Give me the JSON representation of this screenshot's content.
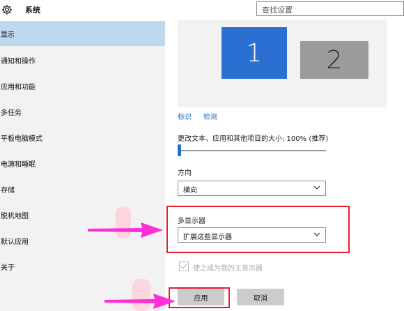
{
  "header": {
    "title": "系统",
    "search_placeholder": "查找设置"
  },
  "sidebar": {
    "items": [
      {
        "label": "显示",
        "active": true
      },
      {
        "label": "通知和操作"
      },
      {
        "label": "应用和功能"
      },
      {
        "label": "多任务"
      },
      {
        "label": "平板电脑模式"
      },
      {
        "label": "电源和睡眠"
      },
      {
        "label": "存储"
      },
      {
        "label": "脱机地图"
      },
      {
        "label": "默认应用"
      },
      {
        "label": "关于"
      }
    ]
  },
  "display": {
    "monitors": [
      "1",
      "2"
    ],
    "identify_label": "标识",
    "detect_label": "检测",
    "scale_label": "更改文本、应用和其他项目的大小: 100% (推荐)",
    "scale_value": 0,
    "orientation_label": "方向",
    "orientation_value": "横向",
    "multi_display_label": "多显示器",
    "multi_display_value": "扩展这些显示器",
    "main_display_checkbox": "使之成为我的主显示器",
    "apply_label": "应用",
    "cancel_label": "取消"
  },
  "colors": {
    "accent": "#1f6fd0",
    "monitor_primary": "#2c6fd3",
    "monitor_secondary": "#9b9b9b",
    "sidebar_active": "#bed8ee",
    "highlight_box": "#e2212b",
    "annotation_arrow": "#ff2fd8"
  },
  "icons": {
    "app": "gear-icon",
    "dropdown": "chevron-down-icon",
    "check": "checkmark-icon",
    "annotation": "arrow-right-icon"
  }
}
